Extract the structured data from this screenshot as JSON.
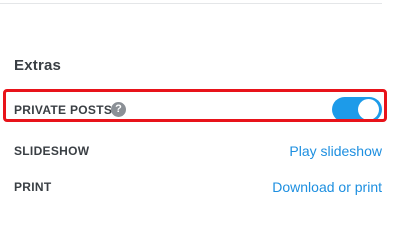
{
  "extras": {
    "title": "Extras",
    "private_posts": {
      "label": "PRIVATE POSTS",
      "help_glyph": "?",
      "help_icon": "question-circle-icon",
      "enabled": true,
      "toggle_color": "#1d9be9"
    },
    "slideshow": {
      "label": "SLIDESHOW",
      "link": "Play slideshow"
    },
    "print": {
      "label": "PRINT",
      "link": "Download or print"
    }
  },
  "colors": {
    "link": "#1d8fe0",
    "highlight": "#e8131a",
    "text": "#3a3f44"
  }
}
